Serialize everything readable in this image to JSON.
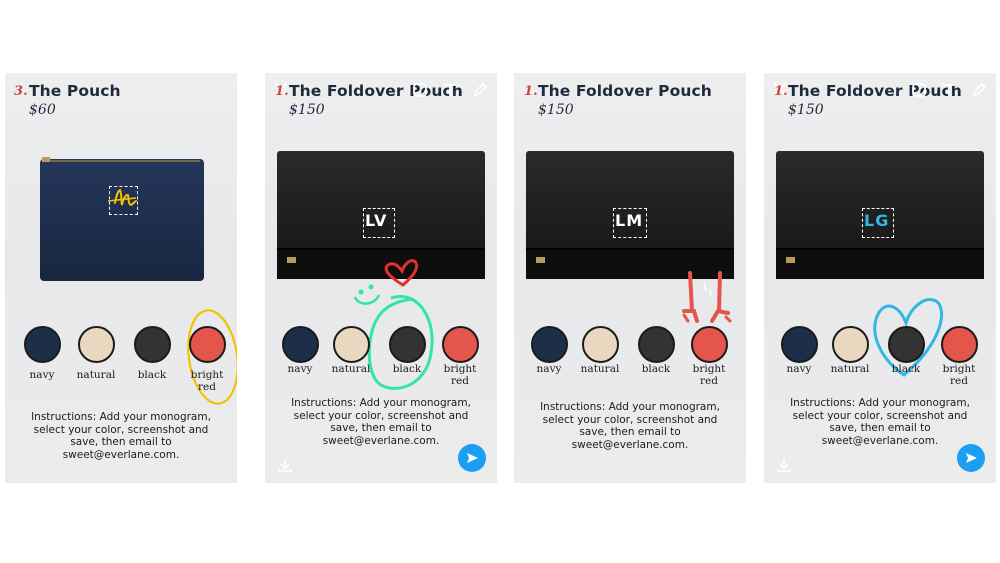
{
  "colors": {
    "navy": "#1d2e4a",
    "natural": "#e9d7c0",
    "black": "#333333",
    "bright_red": "#e4564c",
    "ink": "#1f2a3c",
    "accent_number": "#c8463a",
    "send_blue": "#1c9ff2",
    "yellow_doodle": "#f2c200",
    "green_doodle": "#2fe6a5",
    "red_doodle": "#e0322b",
    "blue_doodle": "#2fb8e6"
  },
  "panels": [
    {
      "number": "3.",
      "title": "The Pouch",
      "price": "$60",
      "monogram": "m",
      "snapchat_icons": false,
      "swatches": [
        "navy",
        "natural",
        "black",
        "bright\nred"
      ],
      "instructions": "Instructions: Add your monogram, select your color, screenshot and save, then email to sweet@everlane.com."
    },
    {
      "number": "1.",
      "title": "The Foldover Pouch",
      "price": "$150",
      "monogram": "LV",
      "snapchat_icons": true,
      "icons": [
        "close-icon",
        "sticker-icon",
        "text-icon",
        "pencil-icon",
        "download-icon",
        "send-icon"
      ],
      "swatches": [
        "navy",
        "natural",
        "black",
        "bright\nred"
      ],
      "instructions": "Instructions: Add your monogram, select your color, screenshot and save, then email to sweet@everlane.com."
    },
    {
      "number": "1.",
      "title": "The Foldover Pouch",
      "price": "$150",
      "monogram": "LM",
      "snapchat_icons": false,
      "swatches": [
        "navy",
        "natural",
        "black",
        "bright\nred"
      ],
      "instructions": "Instructions: Add your monogram, select your color, screenshot and save, then email to sweet@everlane.com."
    },
    {
      "number": "1.",
      "title": "The Foldover Pouch",
      "price": "$150",
      "monogram": "LG",
      "snapchat_icons": true,
      "icons": [
        "close-icon",
        "sticker-icon",
        "text-icon",
        "pencil-icon",
        "download-icon",
        "send-icon"
      ],
      "swatches": [
        "navy",
        "natural",
        "black",
        "bright\nred"
      ],
      "instructions": "Instructions: Add your monogram, select your color, screenshot and save, then email to sweet@everlane.com."
    }
  ],
  "labels": {
    "navy": "navy",
    "natural": "natural",
    "black": "black",
    "bright_red_1": "bright",
    "bright_red_2": "red"
  }
}
